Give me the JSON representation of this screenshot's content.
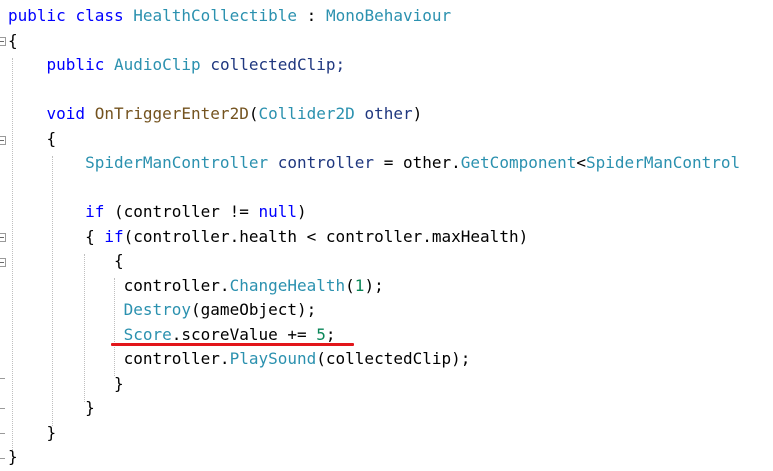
{
  "code": {
    "l1": {
      "a": "public",
      "b": "class",
      "c": "HealthCollectible",
      "d": ":",
      "e": "MonoBehaviour"
    },
    "l2": {
      "a": "{"
    },
    "l3": {
      "a": "public",
      "b": "AudioClip",
      "c": "collectedClip;"
    },
    "l5": {
      "a": "void",
      "b": "OnTriggerEnter2D",
      "c": "(",
      "d": "Collider2D",
      "e": "other",
      "f": ")"
    },
    "l6": {
      "a": "{"
    },
    "l7": {
      "a": "SpiderManController",
      "b": "controller",
      "c": "=",
      "d": "other.",
      "e": "GetComponent",
      "f": "<",
      "g": "SpiderManControl"
    },
    "l9": {
      "a": "if",
      "b": "(controller",
      "c": "!=",
      "d": "null",
      "e": ")"
    },
    "l10": {
      "a": "{",
      "b": "if",
      "c": "(controller.health",
      "d": "<",
      "e": "controller.maxHealth)"
    },
    "l11": {
      "a": "{"
    },
    "l12": {
      "a": "controller.",
      "b": "ChangeHealth",
      "c": "(",
      "d": "1",
      "e": ");"
    },
    "l13": {
      "a": "Destroy",
      "b": "(gameObject);"
    },
    "l14": {
      "a": "Score",
      "b": ".scoreValue",
      "c": "+=",
      "d": "5",
      "e": ";"
    },
    "l15": {
      "a": "controller.",
      "b": "PlaySound",
      "c": "(collectedClip);"
    },
    "l16": {
      "a": "}"
    },
    "l17": {
      "a": "}"
    },
    "l18": {
      "a": "}"
    },
    "l19": {
      "a": "}"
    }
  },
  "colors": {
    "keyword": "#0000ff",
    "type": "#2b91af",
    "method": "#74531f",
    "number": "#098658",
    "underline": "#e2161a"
  }
}
